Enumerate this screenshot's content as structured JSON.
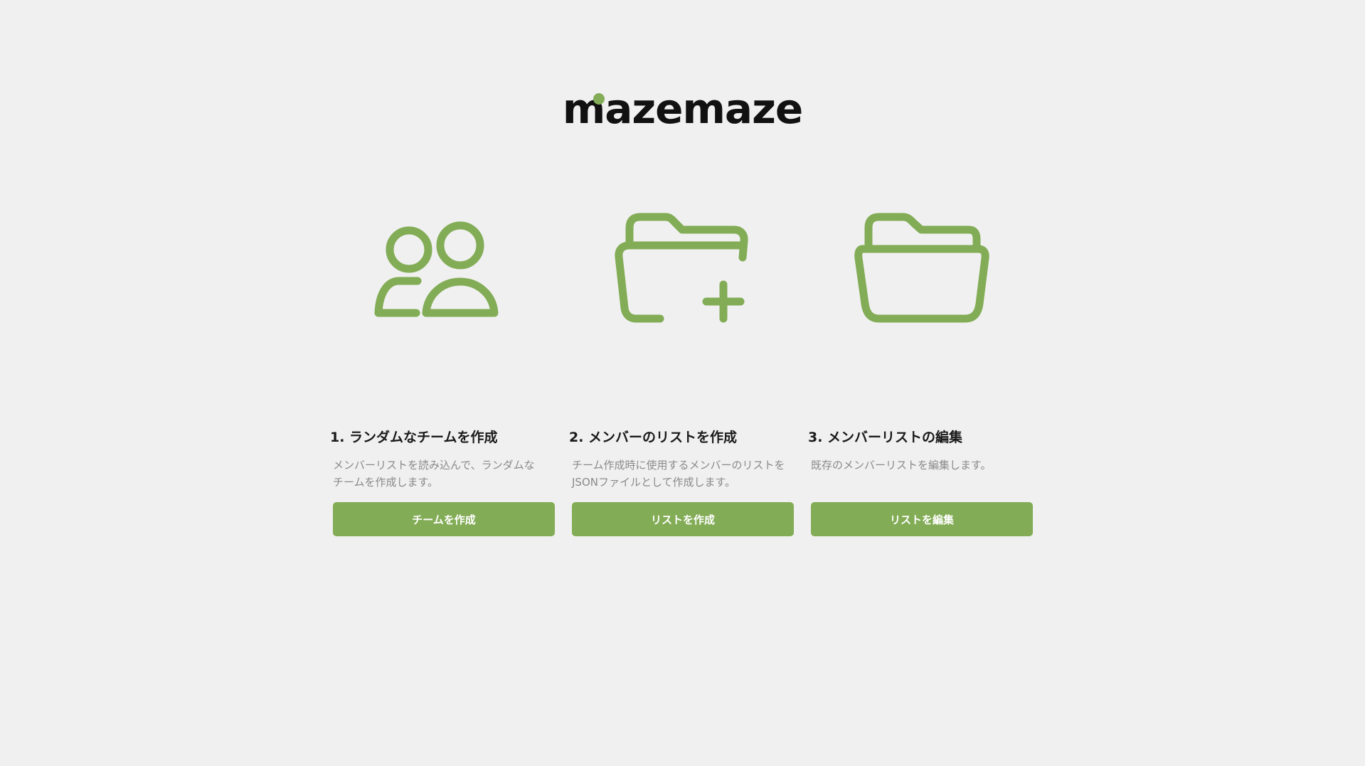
{
  "app": {
    "logo_text": "mazemaze",
    "accent_color": "#82ac55"
  },
  "cards": [
    {
      "icon": "users-icon",
      "title": "1. ランダムなチームを作成",
      "description": "メンバーリストを読み込んで、ランダムな\nチームを作成します。",
      "button_label": "チームを作成"
    },
    {
      "icon": "folder-plus-icon",
      "title": "2. メンバーのリストを作成",
      "description": "チーム作成時に使用するメンバーのリストを\nJSONファイルとして作成します。",
      "button_label": "リストを作成"
    },
    {
      "icon": "folder-open-icon",
      "title": "3. メンバーリストの編集",
      "description": "既存のメンバーリストを編集します。",
      "button_label": "リストを編集"
    }
  ]
}
